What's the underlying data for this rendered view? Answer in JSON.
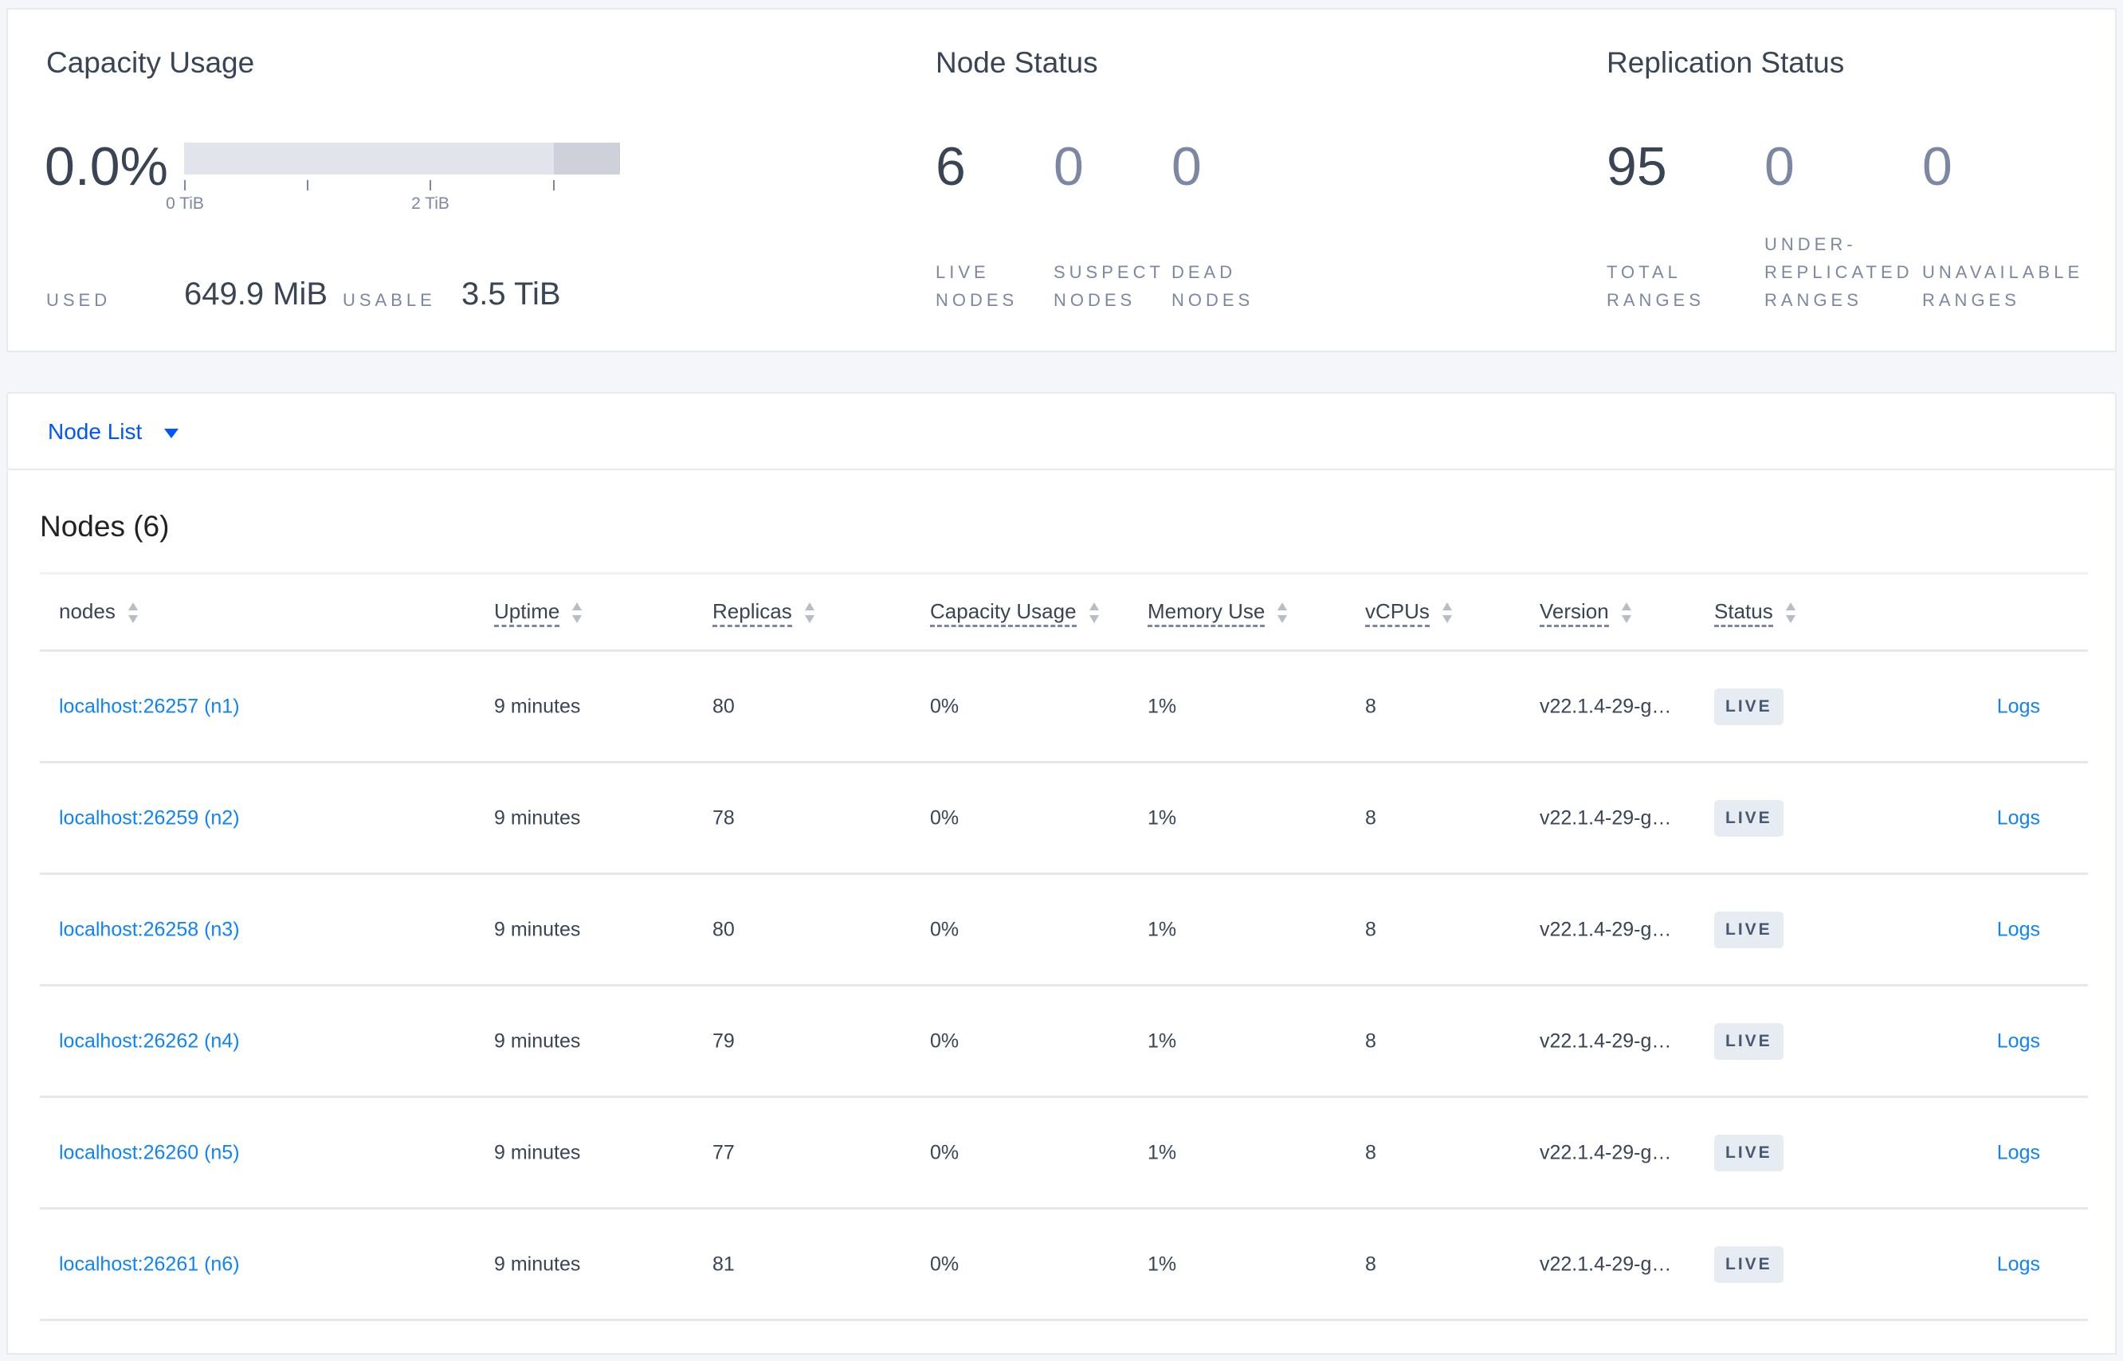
{
  "capacity": {
    "title": "Capacity Usage",
    "percent": "0.0%",
    "used_fraction": 0.0002,
    "axis_ticks": [
      "0 TiB",
      "2 TiB"
    ],
    "used_label": "USED",
    "used_value": "649.9 MiB",
    "usable_label": "USABLE",
    "usable_value": "3.5 TiB"
  },
  "node_status": {
    "title": "Node Status",
    "live": "6",
    "live_l1": "LIVE",
    "live_l2": "NODES",
    "suspect": "0",
    "suspect_l1": "SUSPECT",
    "suspect_l2": "NODES",
    "dead": "0",
    "dead_l1": "DEAD",
    "dead_l2": "NODES"
  },
  "replication": {
    "title": "Replication Status",
    "total": "95",
    "total_l1": "TOTAL",
    "total_l2": "RANGES",
    "under": "0",
    "under_l0": "UNDER-",
    "under_l1": "REPLICATED",
    "under_l2": "RANGES",
    "unavail": "0",
    "unavail_l1": "UNAVAILABLE",
    "unavail_l2": "RANGES"
  },
  "view_selector": {
    "label": "Node List"
  },
  "table": {
    "title": "Nodes (6)",
    "headers": [
      "nodes",
      "Uptime",
      "Replicas",
      "Capacity Usage",
      "Memory Use",
      "vCPUs",
      "Version",
      "Status"
    ],
    "rows": [
      {
        "node": "localhost:26257 (n1)",
        "uptime": "9 minutes",
        "replicas": "80",
        "capacity": "0%",
        "memory": "1%",
        "vcpus": "8",
        "version": "v22.1.4-29-g…",
        "status": "LIVE",
        "logs": "Logs"
      },
      {
        "node": "localhost:26259 (n2)",
        "uptime": "9 minutes",
        "replicas": "78",
        "capacity": "0%",
        "memory": "1%",
        "vcpus": "8",
        "version": "v22.1.4-29-g…",
        "status": "LIVE",
        "logs": "Logs"
      },
      {
        "node": "localhost:26258 (n3)",
        "uptime": "9 minutes",
        "replicas": "80",
        "capacity": "0%",
        "memory": "1%",
        "vcpus": "8",
        "version": "v22.1.4-29-g…",
        "status": "LIVE",
        "logs": "Logs"
      },
      {
        "node": "localhost:26262 (n4)",
        "uptime": "9 minutes",
        "replicas": "79",
        "capacity": "0%",
        "memory": "1%",
        "vcpus": "8",
        "version": "v22.1.4-29-g…",
        "status": "LIVE",
        "logs": "Logs"
      },
      {
        "node": "localhost:26260 (n5)",
        "uptime": "9 minutes",
        "replicas": "77",
        "capacity": "0%",
        "memory": "1%",
        "vcpus": "8",
        "version": "v22.1.4-29-g…",
        "status": "LIVE",
        "logs": "Logs"
      },
      {
        "node": "localhost:26261 (n6)",
        "uptime": "9 minutes",
        "replicas": "81",
        "capacity": "0%",
        "memory": "1%",
        "vcpus": "8",
        "version": "v22.1.4-29-g…",
        "status": "LIVE",
        "logs": "Logs"
      }
    ]
  },
  "colors": {
    "link": "#0f83fc",
    "selector": "#0055ff",
    "text": "#394455",
    "muted": "#7b87a3"
  }
}
